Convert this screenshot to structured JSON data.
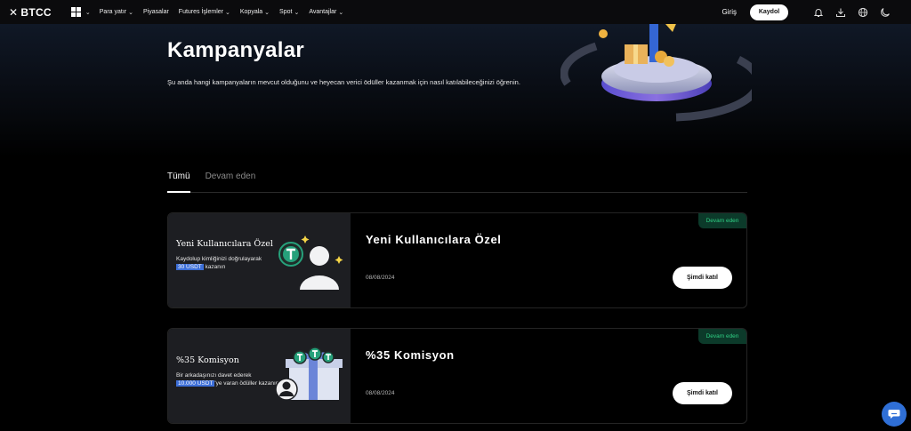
{
  "nav": {
    "brand": "BTCC",
    "menu": [
      {
        "label": "Para yatır",
        "has_dropdown": true
      },
      {
        "label": "Piyasalar",
        "has_dropdown": false
      },
      {
        "label": "Futures İşlemler",
        "has_dropdown": true
      },
      {
        "label": "Kopyala",
        "has_dropdown": true
      },
      {
        "label": "Spot",
        "has_dropdown": true
      },
      {
        "label": "Avantajlar",
        "has_dropdown": true
      }
    ],
    "login": "Giriş",
    "signup": "Kaydol",
    "icons": [
      "bell-icon",
      "download-icon",
      "globe-icon",
      "moon-icon"
    ]
  },
  "hero": {
    "title": "Kampanyalar",
    "subtitle": "Şu anda hangi kampanyaların mevcut olduğunu ve heyecan verici ödüller kazanmak için nasıl katılabileceğinizi öğrenin."
  },
  "tabs": [
    {
      "label": "Tümü",
      "active": true
    },
    {
      "label": "Devam eden",
      "active": false
    }
  ],
  "campaigns": [
    {
      "thumb_title": "Yeni Kullanıcılara Özel",
      "thumb_desc_1": "Kaydolup kimliğinizi doğrulayarak",
      "thumb_highlight": "30 USDT",
      "thumb_desc_2": " kazanın",
      "title": "Yeni Kullanıcılara Özel",
      "date": "08/08/2024",
      "status": "Devam eden",
      "cta": "Şimdi katıl"
    },
    {
      "thumb_title": "%35 Komisyon",
      "thumb_desc_1": "Bir arkadaşınızı davet ederek",
      "thumb_highlight": "10.000 USDT",
      "thumb_desc_2": "'ye varan ödüller kazanın",
      "title": "%35 Komisyon",
      "date": "08/08/2024",
      "status": "Devam eden",
      "cta": "Şimdi katıl"
    }
  ],
  "colors": {
    "background": "#000000",
    "card_thumb": "#1d1e22",
    "status_bg": "#0c3a2a",
    "status_text": "#2fcf84",
    "highlight": "#3d6fd8",
    "tether": "#26a17b",
    "chat": "#2f6fd6"
  }
}
